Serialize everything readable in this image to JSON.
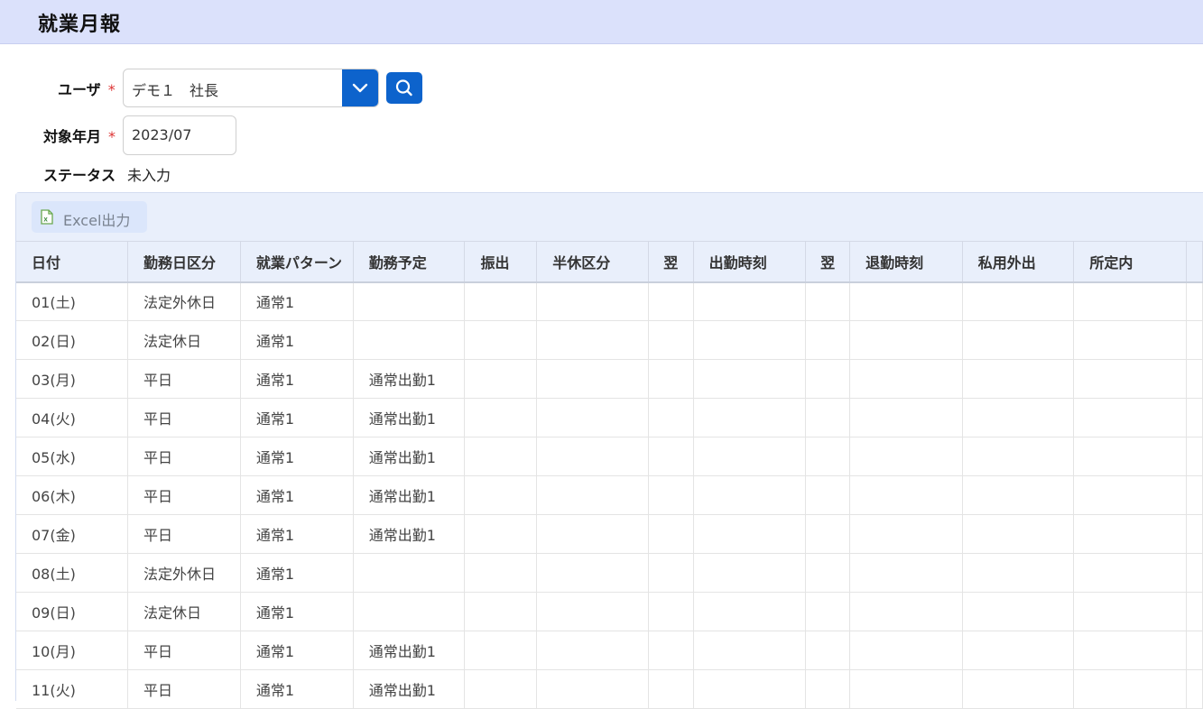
{
  "page": {
    "title": "就業月報"
  },
  "form": {
    "user_label": "ユーザ",
    "user_value": "デモ１　社長",
    "month_label": "対象年月",
    "month_value": "2023/07",
    "status_label": "ステータス",
    "status_value": "未入力",
    "required_mark": "*"
  },
  "toolbar": {
    "excel_label": "Excel出力"
  },
  "table": {
    "columns": [
      "日付",
      "勤務日区分",
      "就業パターン",
      "勤務予定",
      "振出",
      "半休区分",
      "翌",
      "出勤時刻",
      "翌",
      "退勤時刻",
      "私用外出",
      "所定内",
      ""
    ],
    "rows": [
      [
        "01(土)",
        "法定外休日",
        "通常1",
        ""
      ],
      [
        "02(日)",
        "法定休日",
        "通常1",
        ""
      ],
      [
        "03(月)",
        "平日",
        "通常1",
        "通常出勤1"
      ],
      [
        "04(火)",
        "平日",
        "通常1",
        "通常出勤1"
      ],
      [
        "05(水)",
        "平日",
        "通常1",
        "通常出勤1"
      ],
      [
        "06(木)",
        "平日",
        "通常1",
        "通常出勤1"
      ],
      [
        "07(金)",
        "平日",
        "通常1",
        "通常出勤1"
      ],
      [
        "08(土)",
        "法定外休日",
        "通常1",
        ""
      ],
      [
        "09(日)",
        "法定休日",
        "通常1",
        ""
      ],
      [
        "10(月)",
        "平日",
        "通常1",
        "通常出勤1"
      ],
      [
        "11(火)",
        "平日",
        "通常1",
        "通常出勤1"
      ]
    ]
  },
  "icons": {
    "dropdown": "chevron-down-icon",
    "search": "search-icon",
    "excel": "excel-file-icon"
  },
  "colors": {
    "header_bg": "#dbe1fb",
    "accent": "#0d63cc",
    "required": "#dd3333"
  }
}
